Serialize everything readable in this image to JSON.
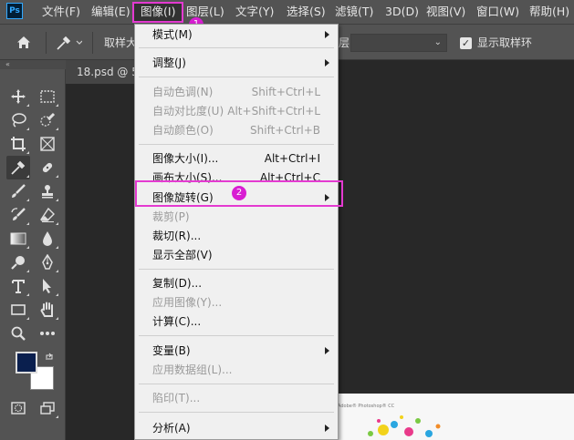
{
  "app": {
    "logo": "Ps"
  },
  "menubar": {
    "items": [
      "文件(F)",
      "编辑(E)",
      "图像(I)",
      "图层(L)",
      "文字(Y)",
      "选择(S)",
      "滤镜(T)",
      "3D(D)",
      "视图(V)",
      "窗口(W)",
      "帮助(H)"
    ],
    "active": "图像(I)"
  },
  "annotations": {
    "step1": "1",
    "step2": "2",
    "highlight_color": "#e43ad1"
  },
  "options_bar": {
    "sample_label": "取样大",
    "layer_fragment": "层",
    "show_ring_label": "显示取样环",
    "show_ring_checked": true
  },
  "document": {
    "tab_title": "18.psd @ 5",
    "preview_caption": "Adobe® Photoshop® CC"
  },
  "colors": {
    "foreground": "#0a1f4e",
    "background": "#ffffff"
  },
  "tools": [
    "move-tool",
    "marquee-tool",
    "lasso-tool",
    "quick-selection-tool",
    "crop-tool",
    "frame-tool",
    "eyedropper-tool",
    "healing-brush-tool",
    "brush-tool",
    "clone-stamp-tool",
    "history-brush-tool",
    "eraser-tool",
    "gradient-tool",
    "blur-tool",
    "dodge-tool",
    "pen-tool",
    "type-tool",
    "path-selection-tool",
    "rectangle-tool",
    "hand-tool",
    "zoom-tool",
    "more-tools",
    "quick-mask-mode",
    "screen-mode"
  ],
  "menu": {
    "items": [
      {
        "label": "模式(M)",
        "shortcut": "",
        "submenu": true,
        "enabled": true
      },
      {
        "label": "调整(J)",
        "shortcut": "",
        "submenu": true,
        "enabled": true
      },
      {
        "label": "自动色调(N)",
        "shortcut": "Shift+Ctrl+L",
        "submenu": false,
        "enabled": false
      },
      {
        "label": "自动对比度(U)",
        "shortcut": "Alt+Shift+Ctrl+L",
        "submenu": false,
        "enabled": false
      },
      {
        "label": "自动颜色(O)",
        "shortcut": "Shift+Ctrl+B",
        "submenu": false,
        "enabled": false
      },
      {
        "label": "图像大小(I)...",
        "shortcut": "Alt+Ctrl+I",
        "submenu": false,
        "enabled": true
      },
      {
        "label": "画布大小(S)...",
        "shortcut": "Alt+Ctrl+C",
        "submenu": false,
        "enabled": true
      },
      {
        "label": "图像旋转(G)",
        "shortcut": "",
        "submenu": true,
        "enabled": true
      },
      {
        "label": "裁剪(P)",
        "shortcut": "",
        "submenu": false,
        "enabled": false
      },
      {
        "label": "裁切(R)...",
        "shortcut": "",
        "submenu": false,
        "enabled": true
      },
      {
        "label": "显示全部(V)",
        "shortcut": "",
        "submenu": false,
        "enabled": true
      },
      {
        "label": "复制(D)...",
        "shortcut": "",
        "submenu": false,
        "enabled": true
      },
      {
        "label": "应用图像(Y)...",
        "shortcut": "",
        "submenu": false,
        "enabled": false
      },
      {
        "label": "计算(C)...",
        "shortcut": "",
        "submenu": false,
        "enabled": true
      },
      {
        "label": "变量(B)",
        "shortcut": "",
        "submenu": true,
        "enabled": true
      },
      {
        "label": "应用数据组(L)...",
        "shortcut": "",
        "submenu": false,
        "enabled": false
      },
      {
        "label": "陷印(T)...",
        "shortcut": "",
        "submenu": false,
        "enabled": false
      },
      {
        "label": "分析(A)",
        "shortcut": "",
        "submenu": true,
        "enabled": true
      }
    ]
  }
}
